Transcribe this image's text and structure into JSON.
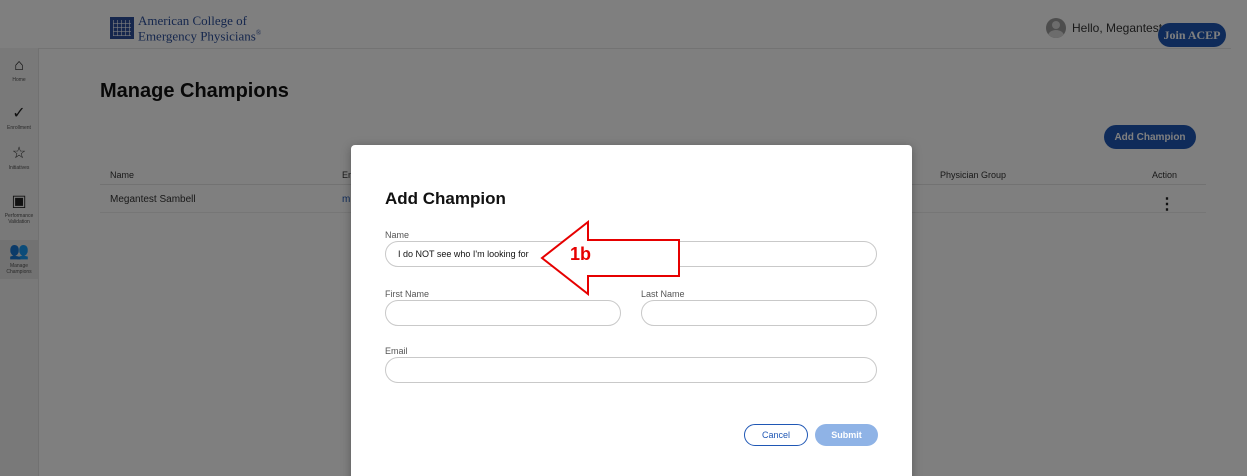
{
  "header": {
    "logo_line1": "American College of",
    "logo_line2": "Emergency Physicians",
    "logo_reg": "®",
    "greeting": "Hello, Megantest",
    "join_label": "Join ACEP"
  },
  "sidebar": {
    "items": [
      {
        "icon": "⌂",
        "label": "Home"
      },
      {
        "icon": "✓",
        "label": "Enrollment"
      },
      {
        "icon": "☆",
        "label": "Initiatives"
      },
      {
        "icon": "▣",
        "label": "Performance Validation"
      },
      {
        "icon": "👥",
        "label": "Manage Champions"
      }
    ]
  },
  "main": {
    "title": "Manage Champions",
    "add_button": "Add Champion",
    "table": {
      "headers": [
        "Name",
        "Em",
        "Physician Group",
        "Action"
      ],
      "rows": [
        {
          "name": "Megantest Sambell",
          "email": "m"
        }
      ]
    }
  },
  "modal": {
    "title": "Add Champion",
    "name_label": "Name",
    "name_value": "I do NOT see who I'm looking for",
    "first_name_label": "First Name",
    "last_name_label": "Last Name",
    "email_label": "Email",
    "cancel_label": "Cancel",
    "submit_label": "Submit"
  },
  "annotation": {
    "label": "1b",
    "color": "#e60000"
  }
}
